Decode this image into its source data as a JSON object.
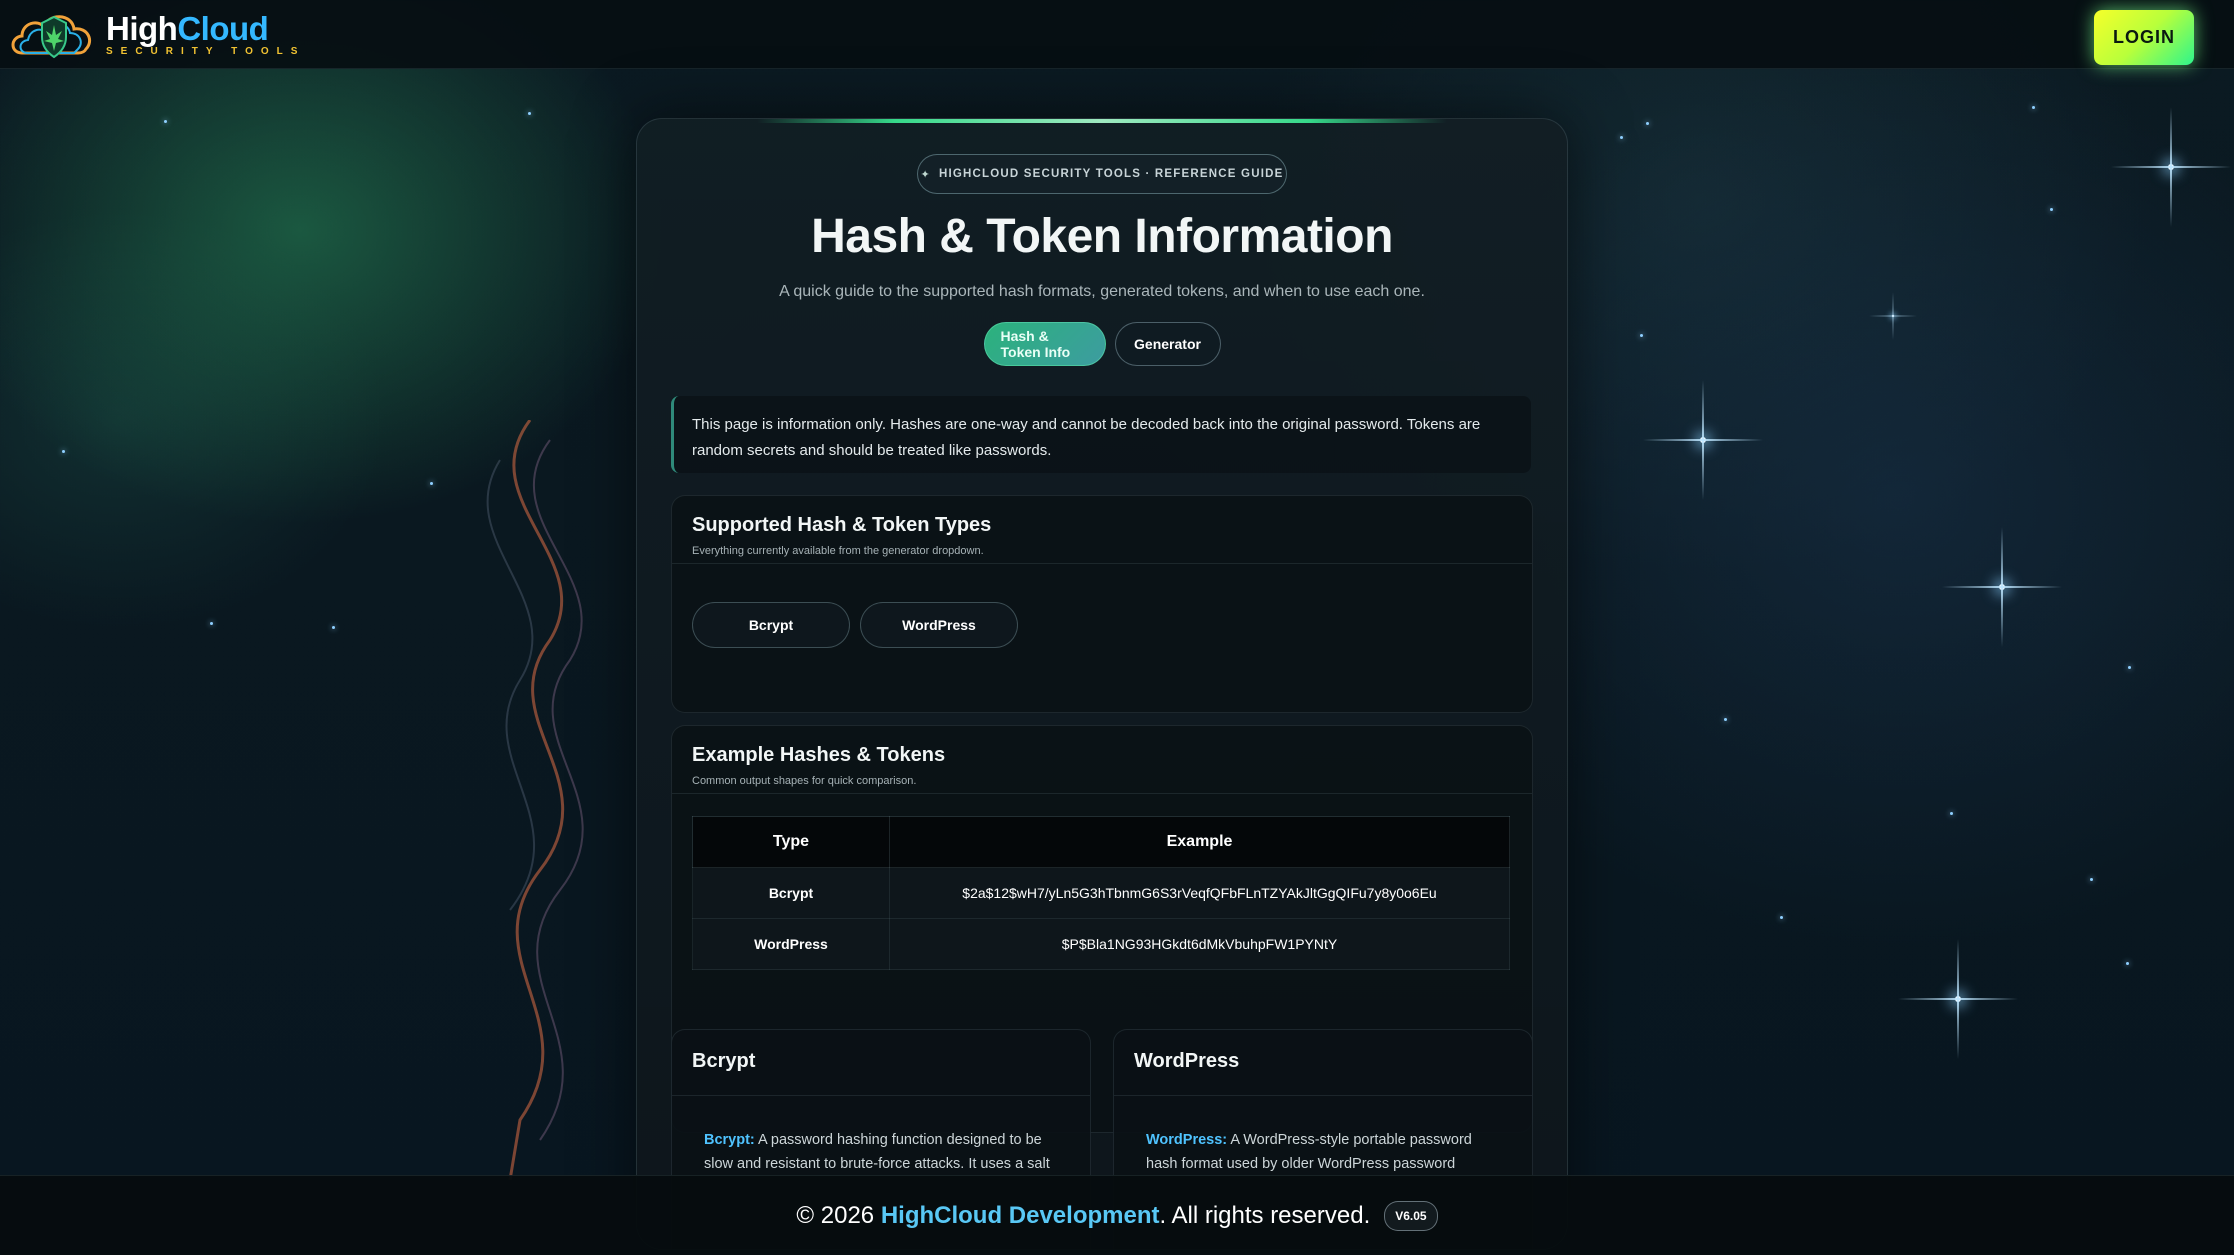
{
  "header": {
    "logo_word_1": "High",
    "logo_word_2": "Cloud",
    "logo_sub": "SECURITY TOOLS",
    "login_label": "LOGIN"
  },
  "hero": {
    "badge": "HIGHCLOUD SECURITY TOOLS · REFERENCE GUIDE",
    "title": "Hash & Token Information",
    "subtitle": "A quick guide to the supported hash formats, generated tokens, and when to use each one.",
    "tabs": [
      {
        "label": "Hash & Token Info",
        "active": true
      },
      {
        "label": "Generator",
        "active": false
      }
    ]
  },
  "notice": "This page is information only. Hashes are one-way and cannot be decoded back into the original password. Tokens are random secrets and should be treated like passwords.",
  "supported": {
    "title": "Supported Hash & Token Types",
    "subtitle": "Everything currently available from the generator dropdown.",
    "types": [
      "Bcrypt",
      "WordPress"
    ]
  },
  "examples": {
    "title": "Example Hashes & Tokens",
    "subtitle": "Common output shapes for quick comparison.",
    "columns": [
      "Type",
      "Example"
    ],
    "rows": [
      {
        "type": "Bcrypt",
        "example": "$2a$12$wH7/yLn5G3hTbnmG6S3rVeqfQFbFLnTZYAkJltGgQIFu7y8y0o6Eu"
      },
      {
        "type": "WordPress",
        "example": "$P$Bla1NG93HGkdt6dMkVbuhpFW1PYNtY"
      }
    ]
  },
  "details": [
    {
      "title": "Bcrypt",
      "keyword": "Bcrypt:",
      "text": " A password hashing function designed to be slow and resistant to brute-force attacks. It uses a salt"
    },
    {
      "title": "WordPress",
      "keyword": "WordPress:",
      "text": " A WordPress-style portable password hash format used by older WordPress password"
    }
  ],
  "footer": {
    "prefix": "© 2026",
    "brand": "HighCloud Development",
    "suffix": ". All rights reserved.",
    "version": "V6.05"
  },
  "colors": {
    "accent": "#36d98a",
    "link": "#4fc3ff",
    "login_gradient": [
      "#f6ff2a",
      "#2ef58c"
    ]
  }
}
